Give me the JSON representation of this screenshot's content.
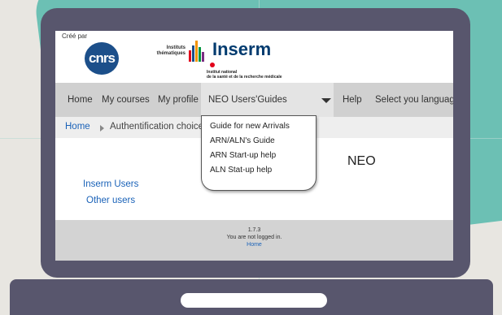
{
  "header": {
    "created_by": "Créé par",
    "cnrs_logo_text": "cnrs",
    "instituts_line1": "Instituts",
    "instituts_line2": "thématiques",
    "inserm_name": "Inserm",
    "inserm_sub_line1": "Institut national",
    "inserm_sub_line2": "de la santé et de la recherche médicale"
  },
  "nav": {
    "items": [
      "Home",
      "My courses",
      "My profile",
      "NEO Users'Guides",
      "Help",
      "Select you language"
    ]
  },
  "dropdown": {
    "items": [
      "Guide for new Arrivals",
      "ARN/ALN's Guide",
      "ARN Start-up help",
      "ALN Stat-up help"
    ]
  },
  "breadcrumb": {
    "home": "Home",
    "current": "Authentification choice"
  },
  "main": {
    "title": "NEO",
    "links": [
      "Inserm Users",
      "Other users"
    ]
  },
  "footer": {
    "version": "1.7.3",
    "login_status": "You are not logged in.",
    "home_link": "Home"
  },
  "colors": {
    "background": "#e8e6e1",
    "teal": "#6cc0b4",
    "laptop": "#58566d",
    "link": "#1a62b8",
    "inserm_blue": "#003b6f",
    "cnrs_blue": "#1c4f8a"
  }
}
